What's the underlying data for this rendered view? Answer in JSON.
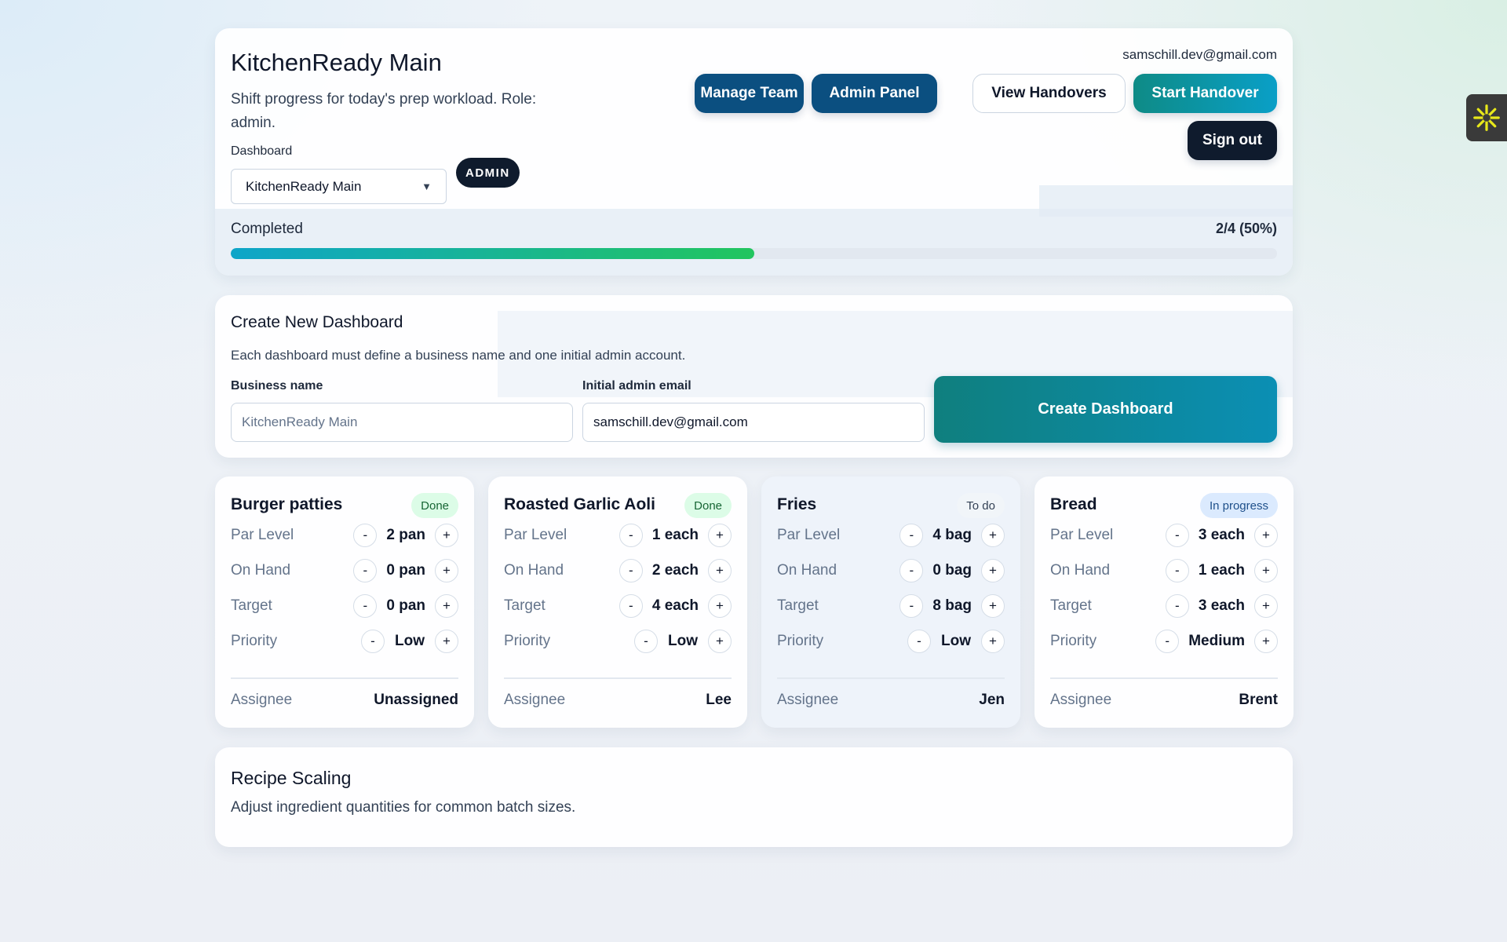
{
  "header": {
    "title": "KitchenReady Main",
    "subtitle": "Shift progress for today's prep workload. Role: admin.",
    "user_email": "samschill.dev@gmail.com",
    "dashboard_label": "Dashboard",
    "dashboard_selected": "KitchenReady Main",
    "role_badge": "ADMIN",
    "buttons": {
      "manage_team": "Manage Team",
      "admin_panel": "Admin Panel",
      "view_handovers": "View Handovers",
      "start_handover": "Start Handover",
      "sign_out": "Sign out"
    },
    "progress": {
      "label": "Completed",
      "value_text": "2/4 (50%)",
      "fraction": 0.5
    }
  },
  "create_dashboard": {
    "title": "Create New Dashboard",
    "description": "Each dashboard must define a business name and one initial admin account.",
    "business_name_label": "Business name",
    "business_name_placeholder": "KitchenReady Main",
    "admin_email_label": "Initial admin email",
    "admin_email_value": "samschill.dev@gmail.com",
    "submit_label": "Create Dashboard"
  },
  "labels": {
    "par_level": "Par Level",
    "on_hand": "On Hand",
    "target": "Target",
    "priority": "Priority",
    "assignee": "Assignee",
    "minus": "-",
    "plus": "+"
  },
  "items": [
    {
      "name": "Burger patties",
      "status": "Done",
      "par_level": "2 pan",
      "on_hand": "0 pan",
      "target": "0 pan",
      "priority": "Low",
      "assignee": "Unassigned"
    },
    {
      "name": "Roasted Garlic Aoli",
      "status": "Done",
      "par_level": "1 each",
      "on_hand": "2 each",
      "target": "4 each",
      "priority": "Low",
      "assignee": "Lee"
    },
    {
      "name": "Fries",
      "status": "To do",
      "par_level": "4 bag",
      "on_hand": "0 bag",
      "target": "8 bag",
      "priority": "Low",
      "assignee": "Jen"
    },
    {
      "name": "Bread",
      "status": "In progress",
      "par_level": "3 each",
      "on_hand": "1 each",
      "target": "3 each",
      "priority": "Medium",
      "assignee": "Brent"
    }
  ],
  "recipe_scaling": {
    "title": "Recipe Scaling",
    "description": "Adjust ingredient quantities for common batch sizes."
  },
  "colors": {
    "primary_dark": "#0b4f80",
    "teal_accent": "#0e8b86",
    "navy": "#0f1b2d",
    "progress_start": "#0ea5c9",
    "progress_end": "#22c55e"
  },
  "icons": {
    "side_widget": "asterisk-sparkle-icon",
    "select_chevron": "chevron-down-icon"
  }
}
